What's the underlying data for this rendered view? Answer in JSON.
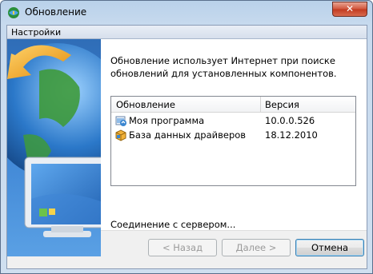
{
  "window": {
    "title": "Обновление",
    "close_label": "✕"
  },
  "header": {
    "label": "Настройки"
  },
  "main": {
    "description": "Обновление использует Интернет при поиске обновлений для установленных компонентов.",
    "list": {
      "columns": [
        "Обновление",
        "Версия"
      ],
      "rows": [
        {
          "name": "Моя программа",
          "version": "10.0.0.526",
          "icon": "program-update-icon"
        },
        {
          "name": "База данных драйверов",
          "version": "18.12.2010",
          "icon": "driver-database-icon"
        }
      ]
    },
    "status": "Соединение с сервером..."
  },
  "buttons": {
    "back": "< Назад",
    "next": "Далее >",
    "cancel": "Отмена"
  },
  "colors": {
    "titlebar": "#b9d1ea",
    "close_button": "#c13a1f",
    "side_art": "#3f86d5"
  }
}
